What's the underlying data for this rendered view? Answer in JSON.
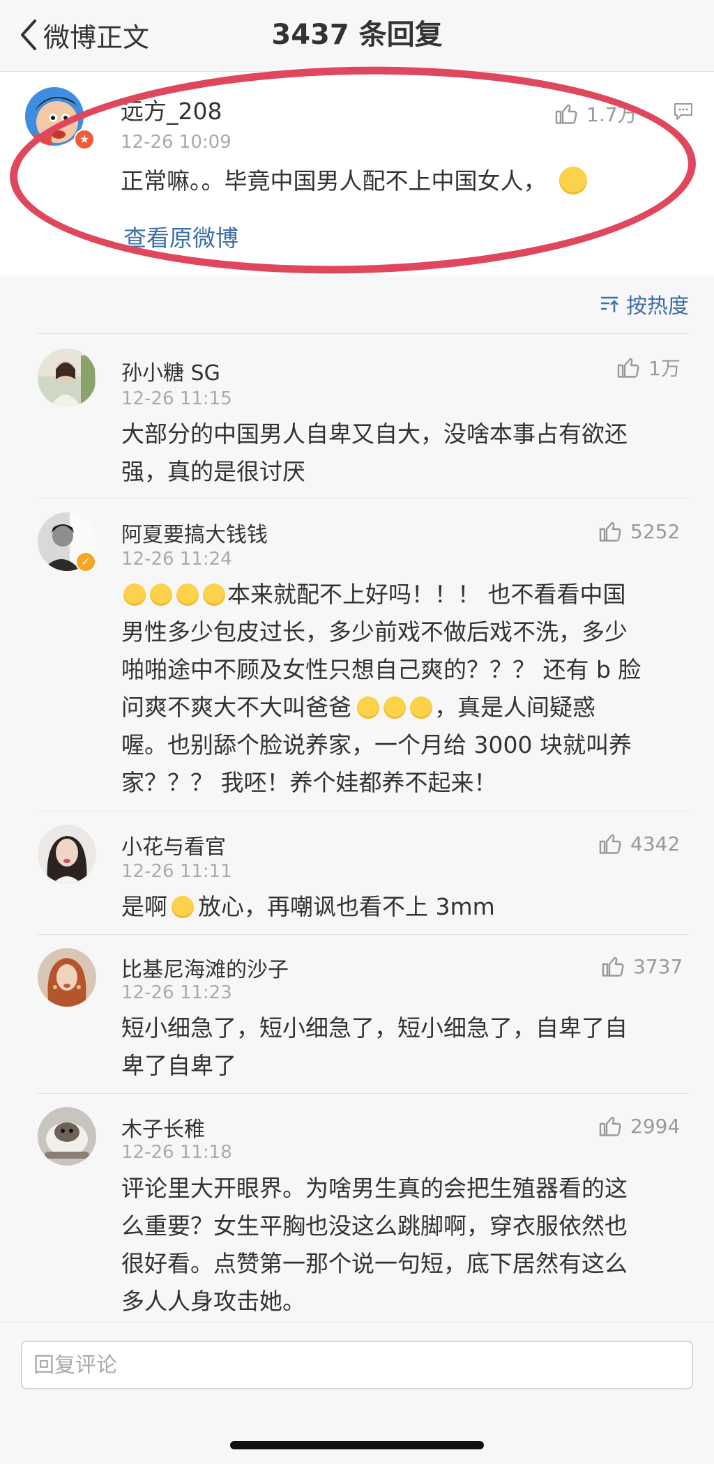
{
  "nav": {
    "back_label": "微博正文",
    "title": "3437 条回复"
  },
  "main_comment": {
    "username": "远方_208",
    "time": "12-26 10:09",
    "text": "正常嘛。。毕竟中国男人配不上中国女人，",
    "likes": "1.7万",
    "view_original": "查看原微博",
    "badge_color": "#f25a3a",
    "highlight_color": "#e0465c"
  },
  "sort_label": "按热度",
  "replies": [
    {
      "username": "孙小糖 SG",
      "time": "12-26 11:15",
      "likes": "1万",
      "lines": [
        "大部分的中国男人自卑又自大，没啥本事占有欲还",
        "强，真的是很讨厌"
      ]
    },
    {
      "username": "阿夏要搞大钱钱",
      "time": "12-26 11:24",
      "likes": "5252",
      "badge_color": "#f5a623",
      "lines": [
        "本来就配不上好吗！！！ 也不看看中国",
        "男性多少包皮过长，多少前戏不做后戏不洗，多少",
        "啪啪途中不顾及女性只想自己爽的？？？ 还有 b 脸",
        "问爽不爽大不大叫爸爸",
        "，真是人间疑惑",
        "喔。也别舔个脸说养家，一个月给 3000 块就叫养",
        "家？？？ 我呸！养个娃都养不起来！"
      ]
    },
    {
      "username": "小花与看官",
      "time": "12-26 11:11",
      "likes": "4342",
      "lines": [
        "是啊",
        "放心，再嘲讽也看不上 3mm"
      ]
    },
    {
      "username": "比基尼海滩的沙子",
      "time": "12-26 11:23",
      "likes": "3737",
      "lines": [
        "短小细急了，短小细急了，短小细急了，自卑了自",
        "卑了自卑了"
      ]
    },
    {
      "username": "木子长稚",
      "time": "12-26 11:18",
      "likes": "2994",
      "lines": [
        "评论里大开眼界。为啥男生真的会把生殖器看的这",
        "么重要？女生平胸也没这么跳脚啊，穿衣服依然也",
        "很好看。点赞第一那个说一句短，底下居然有这么",
        "多人人身攻击她。"
      ]
    }
  ],
  "reply_input": {
    "placeholder": "回复评论"
  }
}
